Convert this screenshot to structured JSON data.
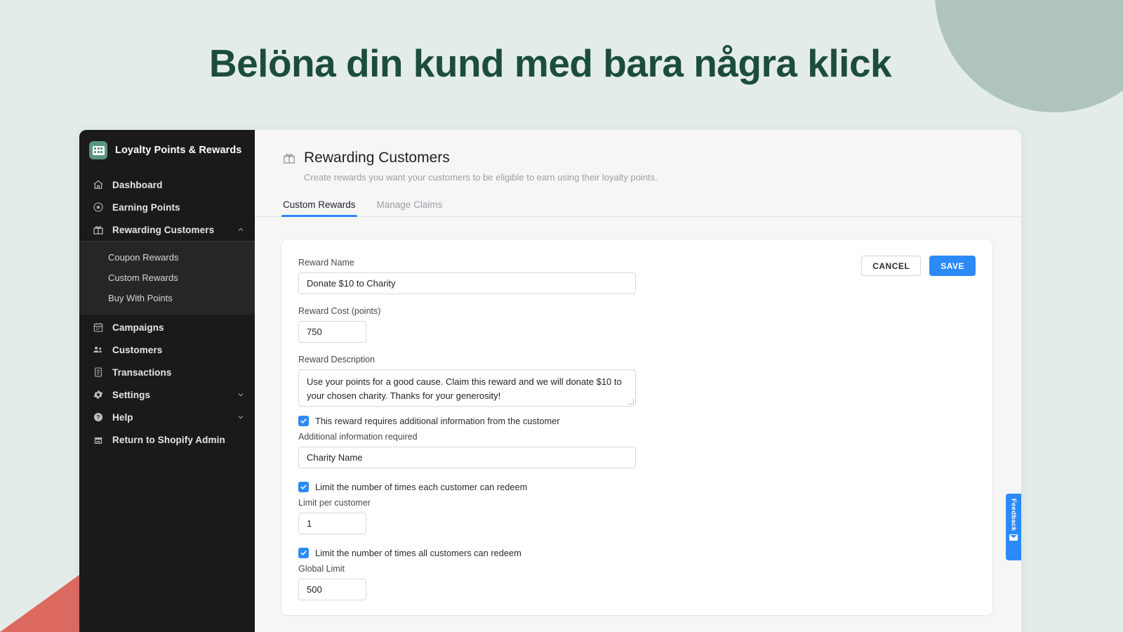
{
  "headline": "Belöna din kund med bara några klick",
  "theme": {
    "page_bg": "#e4ecea",
    "headline_color": "#1c4d3c",
    "circle_color": "#aec4bd",
    "triangle_color": "#dd6a60",
    "accent_blue": "#2c8af8",
    "sidebar_bg": "#1a1a1a",
    "submenu_bg": "#262626",
    "logo_green": "#5c9483"
  },
  "sidebar": {
    "brand": "Loyalty Points & Rewards",
    "brand_icon": "app-logo-icon",
    "items": [
      {
        "label": "Dashboard",
        "icon": "home-icon",
        "chevron": ""
      },
      {
        "label": "Earning Points",
        "icon": "star-circle-icon",
        "chevron": ""
      },
      {
        "label": "Rewarding Customers",
        "icon": "gift-icon",
        "chevron": "chevron-up-icon"
      },
      {
        "label": "Campaigns",
        "icon": "calendar-icon",
        "chevron": ""
      },
      {
        "label": "Customers",
        "icon": "people-icon",
        "chevron": ""
      },
      {
        "label": "Transactions",
        "icon": "list-document-icon",
        "chevron": ""
      },
      {
        "label": "Settings",
        "icon": "gear-icon",
        "chevron": "chevron-down-icon"
      },
      {
        "label": "Help",
        "icon": "question-circle-icon",
        "chevron": "chevron-down-icon"
      },
      {
        "label": "Return to Shopify Admin",
        "icon": "storefront-icon",
        "chevron": ""
      }
    ],
    "submenu": [
      {
        "label": "Coupon Rewards"
      },
      {
        "label": "Custom Rewards"
      },
      {
        "label": "Buy With Points"
      }
    ]
  },
  "main": {
    "title": "Rewarding Customers",
    "title_icon": "gift-icon",
    "subtitle": "Create rewards you want your customers to be eligible to earn using their loyalty points.",
    "tabs": [
      {
        "label": "Custom Rewards",
        "active": true
      },
      {
        "label": "Manage Claims",
        "active": false
      }
    ]
  },
  "form": {
    "cancel_label": "CANCEL",
    "save_label": "SAVE",
    "reward_name": {
      "label": "Reward Name",
      "value": "Donate $10 to Charity",
      "placeholder": "Reward Name"
    },
    "reward_cost": {
      "label": "Reward Cost (points)",
      "value": "750",
      "placeholder": "0"
    },
    "reward_description": {
      "label": "Reward Description",
      "value": "Use your points for a good cause. Claim this reward and we will donate $10 to your chosen charity. Thanks for your generosity!",
      "placeholder": "Reward Description"
    },
    "additional_info_checkbox": {
      "label": "This reward requires additional information from the customer",
      "checked": true
    },
    "additional_info": {
      "label": "Additional information required",
      "value": "Charity Name",
      "placeholder": "Additional information required"
    },
    "limit_per_customer_checkbox": {
      "label": "Limit the number of times each customer can redeem",
      "checked": true
    },
    "limit_per_customer": {
      "label": "Limit per customer",
      "value": "1",
      "placeholder": "0"
    },
    "global_limit_checkbox": {
      "label": "Limit the number of times all customers can redeem",
      "checked": true
    },
    "global_limit": {
      "label": "Global Limit",
      "value": "500",
      "placeholder": "0"
    }
  },
  "feedback": {
    "label": "Feedback",
    "icon": "envelope-icon"
  }
}
